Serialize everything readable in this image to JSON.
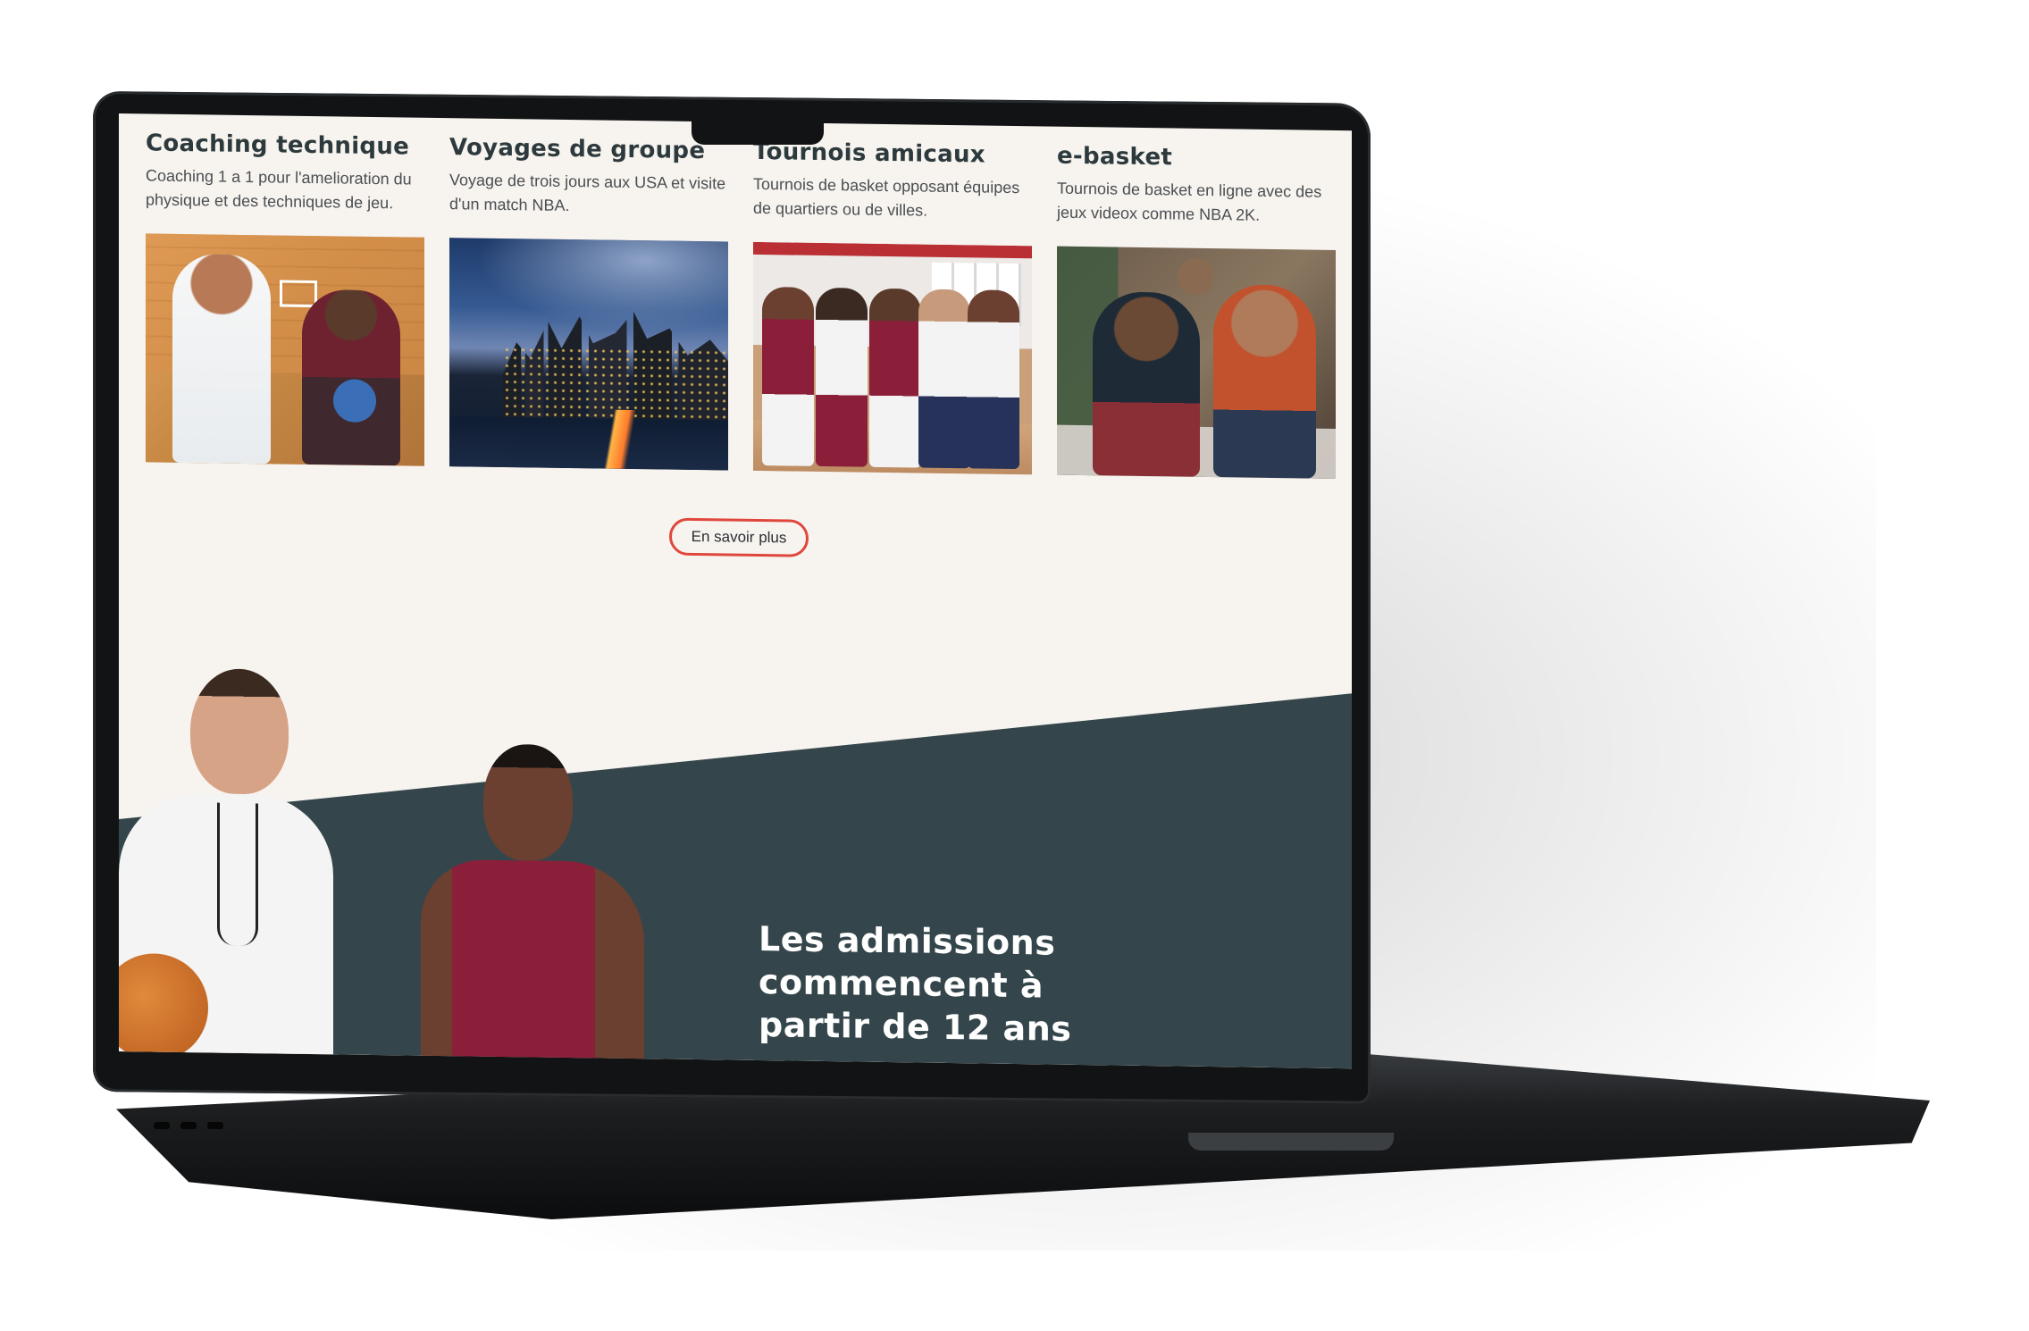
{
  "cards": [
    {
      "title": "Coaching technique",
      "description": "Coaching 1 a 1 pour l'amelioration du physique et des techniques de jeu.",
      "image": "coach-and-player-photo"
    },
    {
      "title": "Voyages de groupe",
      "description": "Voyage de trois jours aux USA et visite d'un match NBA.",
      "image": "new-york-city-skyline-photo"
    },
    {
      "title": "Tournois amicaux",
      "description": "Tournois de basket opposant équipes de quartiers ou de villes.",
      "image": "basketball-team-huddle-photo"
    },
    {
      "title": "e-basket",
      "description": "Tournois de basket en ligne avec des jeux videox comme NBA 2K.",
      "image": "video-gamers-on-sofa-photo"
    }
  ],
  "cta": {
    "label": "En savoir plus"
  },
  "admissions": {
    "heading": "Les admissions commencent à partir de 12 ans"
  },
  "colors": {
    "background": "#f7f3ef",
    "dark_band": "#34464b",
    "accent": "#e0473c",
    "title": "#2d3a3d"
  }
}
